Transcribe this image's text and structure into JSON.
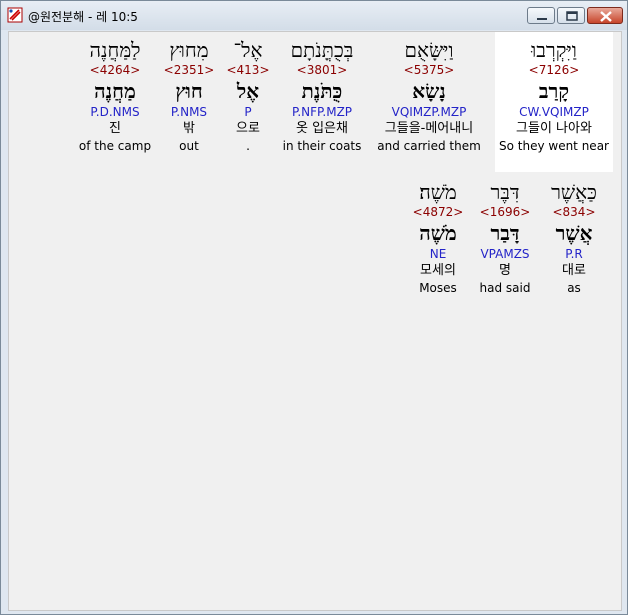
{
  "window": {
    "title": "@원전분해 - 레 10:5",
    "buttons": {
      "minimize": "minimize",
      "maximize": "maximize",
      "close": "close"
    }
  },
  "words": [
    {
      "hebrew": "וַיִּקְרְבוּ",
      "strong": "<7126>",
      "lemma": "קָרַב",
      "morph": "CW.VQIMZP",
      "korean": "그들이 나아와",
      "english": "So they went near",
      "selected": true
    },
    {
      "hebrew": "וַיִּשָּׂאֻם",
      "strong": "<5375>",
      "lemma": "נָשָׂא",
      "morph": "VQIMZP.MZP",
      "korean": "그들을-메어내니",
      "english": "and carried them",
      "selected": false
    },
    {
      "hebrew": "בְּכֻתֳּנֹתָם",
      "strong": "<3801>",
      "lemma": "כֻּתֹּנֶת",
      "morph": "P.NFP.MZP",
      "korean": "옷 입은채",
      "english": "in their coats",
      "selected": false
    },
    {
      "hebrew": "אֶל־",
      "strong": "<413>",
      "lemma": "אֶל",
      "morph": "P",
      "korean": "으로",
      "english": ".",
      "selected": false
    },
    {
      "hebrew": "מִחוּץ",
      "strong": "<2351>",
      "lemma": "חוּץ",
      "morph": "P.NMS",
      "korean": "밖",
      "english": "out",
      "selected": false
    },
    {
      "hebrew": "לַמַּחֲנֶה",
      "strong": "<4264>",
      "lemma": "מַחֲנֶה",
      "morph": "P.D.NMS",
      "korean": "진",
      "english": "of the camp",
      "selected": false
    },
    {
      "hebrew": "כַּאֲשֶׁר",
      "strong": "<834>",
      "lemma": "אֲשֶׁר",
      "morph": "P.R",
      "korean": "대로",
      "english": "as",
      "selected": false
    },
    {
      "hebrew": "דִּבֶּר",
      "strong": "<1696>",
      "lemma": "דָּבַר",
      "morph": "VPAMZS",
      "korean": "명",
      "english": "had said",
      "selected": false
    },
    {
      "hebrew": "מֹשֶׁה׃",
      "strong": "<4872>",
      "lemma": "מֹשֶׁה",
      "morph": "NE",
      "korean": "모세의",
      "english": "Moses",
      "selected": false
    }
  ]
}
